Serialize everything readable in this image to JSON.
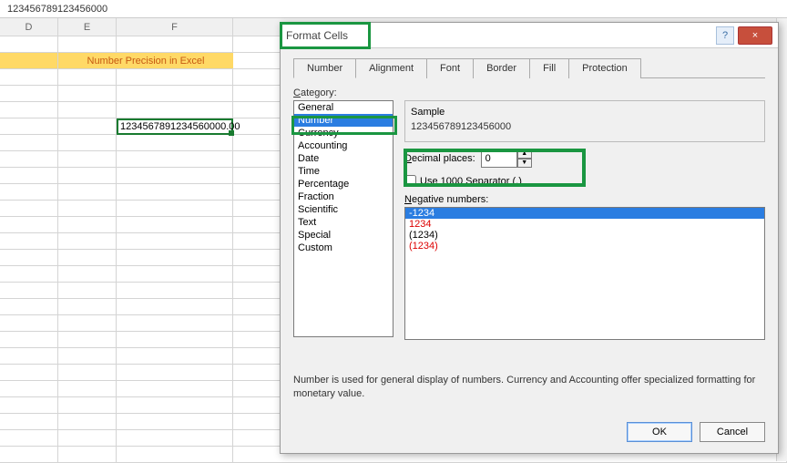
{
  "formula_bar": "123456789123456000",
  "columns": [
    "D",
    "E",
    "F"
  ],
  "banner": "Number Precision in Excel",
  "selected_cell_value": "1234567891234560000.00",
  "dialog": {
    "title": "Format Cells",
    "help_tip": "?",
    "close_tip": "×",
    "tabs": [
      "Number",
      "Alignment",
      "Font",
      "Border",
      "Fill",
      "Protection"
    ],
    "active_tab": "Number",
    "category_label": "Category:",
    "categories": [
      "General",
      "Number",
      "Currency",
      "Accounting",
      "Date",
      "Time",
      "Percentage",
      "Fraction",
      "Scientific",
      "Text",
      "Special",
      "Custom"
    ],
    "selected_category": "Number",
    "sample_label": "Sample",
    "sample_value": "123456789123456000",
    "decimal_label": "Decimal places:",
    "decimal_value": "0",
    "use_separator_label": "Use 1000 Separator (,)",
    "negative_label": "Negative numbers:",
    "negative_numbers": [
      {
        "text": "-1234",
        "cls": "sel"
      },
      {
        "text": "1234",
        "cls": "red"
      },
      {
        "text": "(1234)",
        "cls": ""
      },
      {
        "text": "(1234)",
        "cls": "red"
      }
    ],
    "description": "Number is used for general display of numbers.  Currency and Accounting offer specialized formatting for monetary value.",
    "ok": "OK",
    "cancel": "Cancel"
  }
}
